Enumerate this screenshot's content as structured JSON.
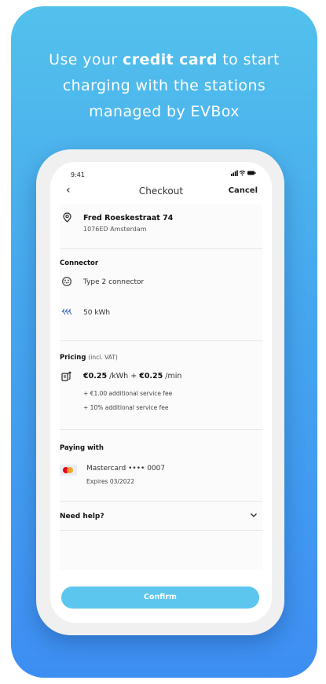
{
  "headline": {
    "line1_prefix": "Use your ",
    "line1_bold": "credit card",
    "line1_suffix": " to start",
    "line2": "charging with the stations",
    "line3": "managed by EVBox"
  },
  "status_bar": {
    "time": "9:41",
    "icons": "signal-wifi-battery"
  },
  "nav": {
    "back_icon": "chevron-left-icon",
    "back_glyph": "‹",
    "title": "Checkout",
    "cancel": "Cancel"
  },
  "location": {
    "name": "Fred Roeskestraat 74",
    "city": "1076ED Amsterdam",
    "icon": "location-pin-icon"
  },
  "connector": {
    "heading": "Connector",
    "type": "Type 2 connector",
    "energy": "50 kWh"
  },
  "pricing": {
    "heading": "Pricing",
    "heading_note": "(incl. VAT)",
    "price_kwh": "€0.25",
    "unit_kwh": " /kWh + ",
    "price_min": "€0.25",
    "unit_min": " /min",
    "fee1": "+ €1.00 additional service fee",
    "fee2": "+ 10% additional service fee"
  },
  "payment": {
    "heading": "Paying with",
    "card": "Mastercard •••• 0007",
    "expires": "Expires 03/2022"
  },
  "help": {
    "label": "Need help?",
    "icon": "chevron-down-icon"
  },
  "confirm": {
    "label": "Confirm"
  },
  "colors": {
    "bg_top": "#52c1ec",
    "bg_bottom": "#3d8ef2",
    "confirm": "#5cc6ee",
    "mastercard_red": "#eb001b",
    "mastercard_orange": "#f79e1b"
  }
}
